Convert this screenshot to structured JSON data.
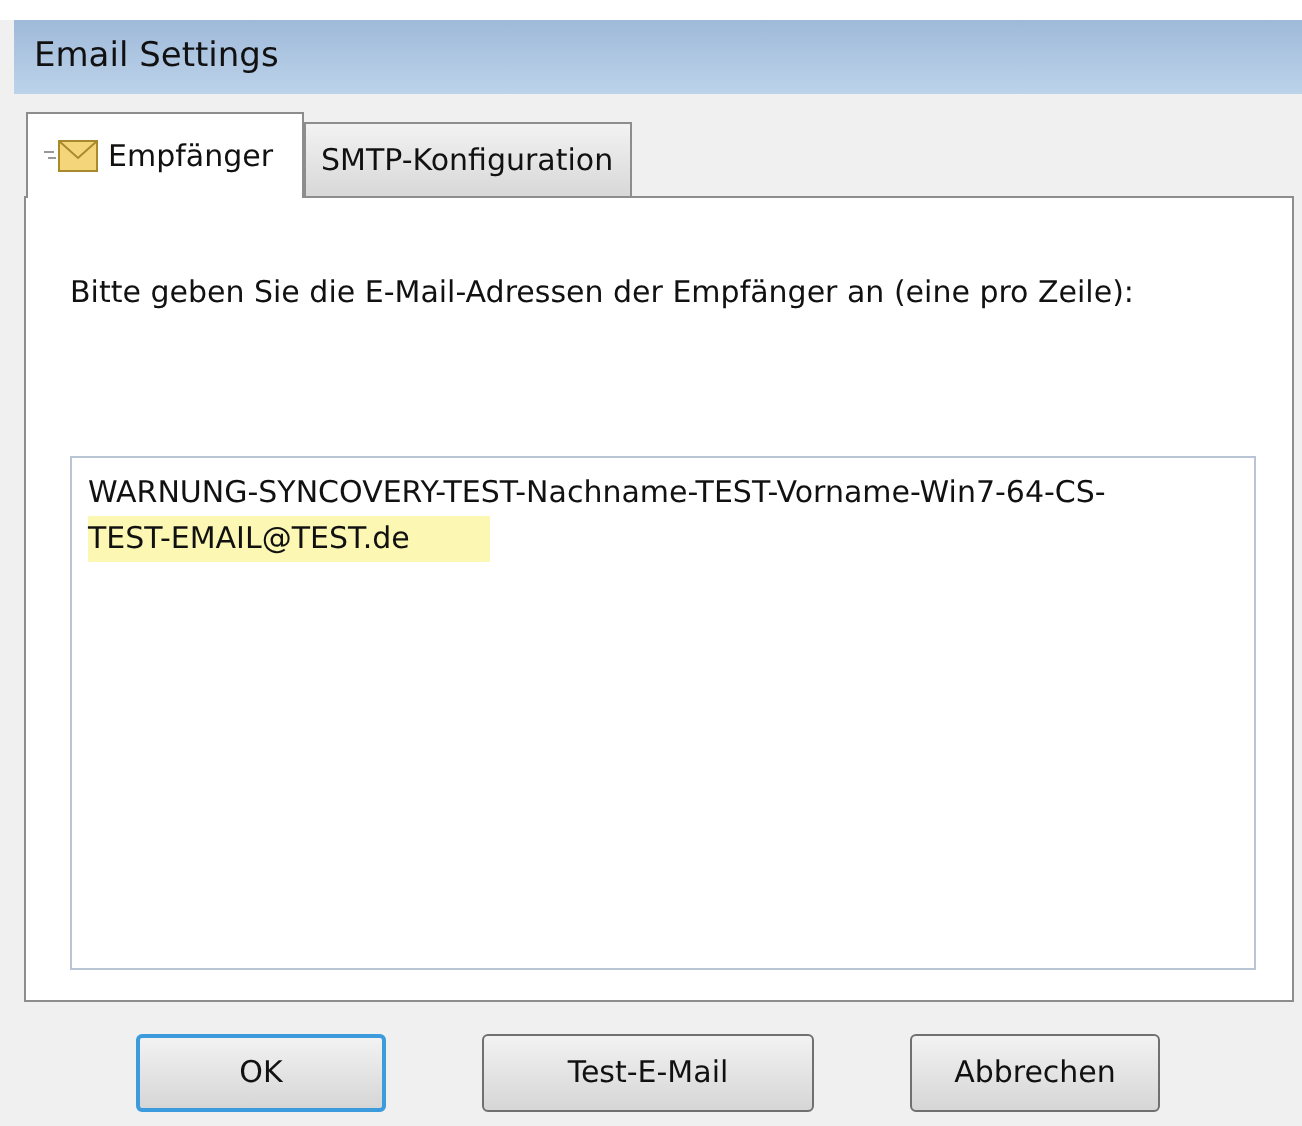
{
  "window": {
    "title": "Email Settings"
  },
  "tabs": [
    {
      "label": "Empfänger",
      "selected": true,
      "kind": "envelope"
    },
    {
      "label": "SMTP-Konfiguration",
      "selected": false,
      "kind": "plain"
    }
  ],
  "instruction": "Bitte geben Sie die E-Mail-Adressen der Empfänger an (eine pro Zeile):",
  "recipients": {
    "lines": [
      {
        "text": "WARNUNG-SYNCOVERY-TEST-Nachname-TEST-Vorname-Win7-64-CS-",
        "highlighted": false
      },
      {
        "text": "TEST-EMAIL@TEST.de",
        "highlighted": true
      }
    ]
  },
  "buttons": [
    {
      "label": "OK",
      "focused": true
    },
    {
      "label": "Test-E-Mail",
      "focused": false
    },
    {
      "label": "Abbrechen",
      "focused": false
    }
  ]
}
